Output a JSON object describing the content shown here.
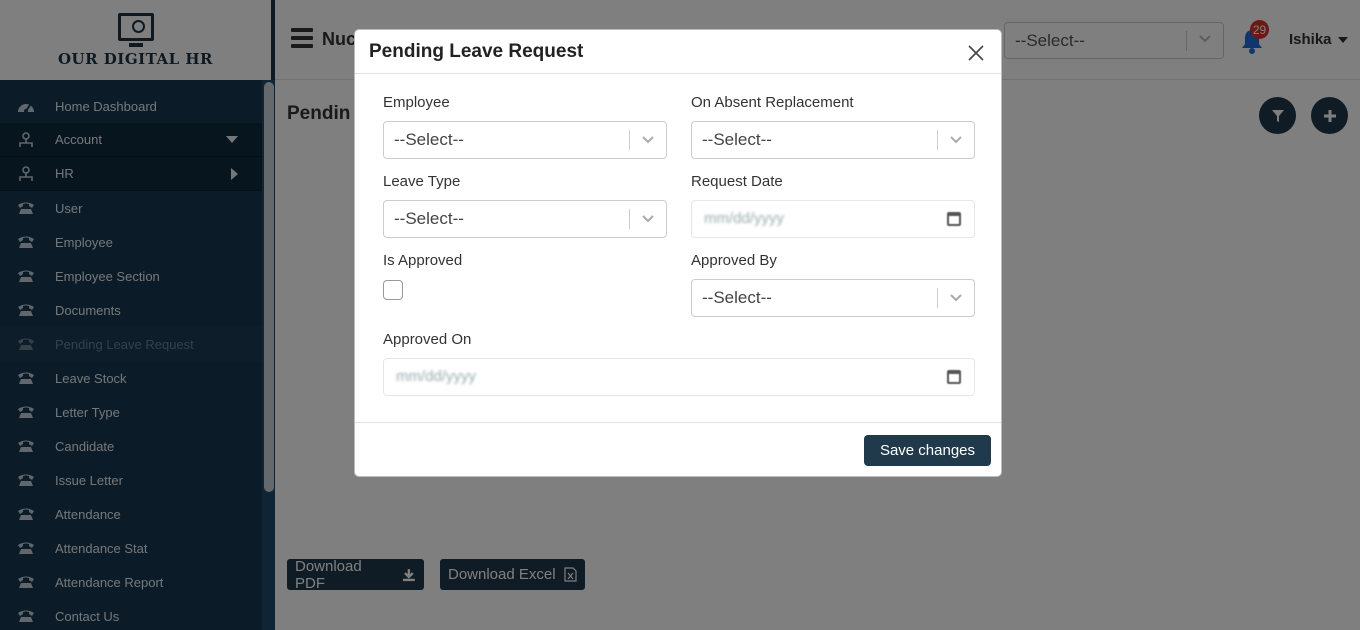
{
  "app": {
    "logo_text": "OUR DIGITAL HR"
  },
  "sidebar": {
    "items": [
      {
        "label": "Home Dashboard"
      },
      {
        "label": "Account"
      },
      {
        "label": "HR"
      },
      {
        "label": "User"
      },
      {
        "label": "Employee"
      },
      {
        "label": "Employee Section"
      },
      {
        "label": "Documents"
      },
      {
        "label": "Pending Leave Request"
      },
      {
        "label": "Leave Stock"
      },
      {
        "label": "Letter Type"
      },
      {
        "label": "Candidate"
      },
      {
        "label": "Issue Letter"
      },
      {
        "label": "Attendance"
      },
      {
        "label": "Attendance Stat"
      },
      {
        "label": "Attendance Report"
      },
      {
        "label": "Contact Us"
      }
    ]
  },
  "topbar": {
    "company_partial": "Nuc",
    "select_value": "--Select--",
    "notification_count": "29",
    "user_name": "Ishika"
  },
  "main": {
    "page_title_partial": "Pendin",
    "download_pdf": "Download PDF",
    "download_excel": "Download Excel"
  },
  "modal": {
    "title": "Pending Leave Request",
    "fields": {
      "employee": {
        "label": "Employee",
        "value": "--Select--"
      },
      "replacement": {
        "label": "On Absent Replacement",
        "value": "--Select--"
      },
      "leave_type": {
        "label": "Leave Type",
        "value": "--Select--"
      },
      "request_date": {
        "label": "Request Date",
        "placeholder": "mm/dd/yyyy"
      },
      "is_approved": {
        "label": "Is Approved",
        "checked": false
      },
      "approved_by": {
        "label": "Approved By",
        "value": "--Select--"
      },
      "approved_on": {
        "label": "Approved On",
        "placeholder": "mm/dd/yyyy"
      }
    },
    "save_label": "Save changes"
  },
  "colors": {
    "sidebar_bg": "#163851",
    "primary_button": "#20394b",
    "badge": "#d9312b",
    "bell": "#1e6fd9"
  }
}
